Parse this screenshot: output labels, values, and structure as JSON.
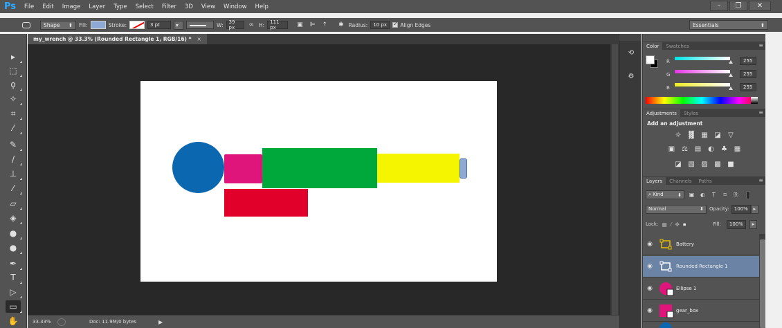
{
  "app": {
    "logo": "Ps",
    "menu": [
      "File",
      "Edit",
      "Image",
      "Layer",
      "Type",
      "Select",
      "Filter",
      "3D",
      "View",
      "Window",
      "Help"
    ],
    "window_controls": [
      "–",
      "❐",
      "✕"
    ]
  },
  "options_bar": {
    "mode": "Shape",
    "fill_label": "Fill:",
    "stroke_label": "Stroke:",
    "stroke_width": "3 pt",
    "w_label": "W:",
    "w_value": "39 px",
    "link_icon": "∞",
    "h_label": "H:",
    "h_value": "111 px",
    "radius_label": "Radius:",
    "radius_value": "10 px",
    "align_edges": "Align Edges",
    "workspace": "Essentials"
  },
  "document": {
    "tab_title": "my_wrench @ 33.3% (Rounded Rectangle 1, RGB/16) *",
    "tab_close": "×",
    "zoom": "33.33%",
    "doc_info": "Doc: 11.9M/0 bytes",
    "canvas_colors": {
      "background": "#ffffff",
      "ellipse": "#0a67b0",
      "magenta": "#e0157c",
      "green": "#00a83b",
      "yellow": "#f5f500",
      "red": "#e0002a",
      "handle": "#8eaad4"
    }
  },
  "color_panel": {
    "tabs": [
      "Color",
      "Swatches"
    ],
    "channels": [
      {
        "label": "R",
        "value": "255",
        "color": "#00e5e5"
      },
      {
        "label": "G",
        "value": "255",
        "color": "#e535e5"
      },
      {
        "label": "B",
        "value": "255",
        "color": "#eeee22"
      }
    ]
  },
  "adjustments_panel": {
    "tabs": [
      "Adjustments",
      "Styles"
    ],
    "title": "Add an adjustment",
    "rows": [
      [
        "☼",
        "▓",
        "▦",
        "◪",
        "▽"
      ],
      [
        "▣",
        "⚖",
        "▤",
        "◐",
        "♣",
        "▦"
      ],
      [
        "◪",
        "▧",
        "▨",
        "▩",
        "■"
      ]
    ]
  },
  "layers_panel": {
    "tabs": [
      "Layers",
      "Channels",
      "Paths"
    ],
    "kind": "⌕ Kind",
    "blend_mode": "Normal",
    "opacity_label": "Opacity:",
    "opacity_value": "100%",
    "lock_label": "Lock:",
    "fill_label": "Fill:",
    "fill_value": "100%",
    "layers": [
      {
        "name": "Battery",
        "selected": false
      },
      {
        "name": "Rounded Rectangle 1",
        "selected": true
      },
      {
        "name": "Ellipse 1",
        "selected": false
      },
      {
        "name": "gear_box",
        "selected": false
      }
    ]
  }
}
